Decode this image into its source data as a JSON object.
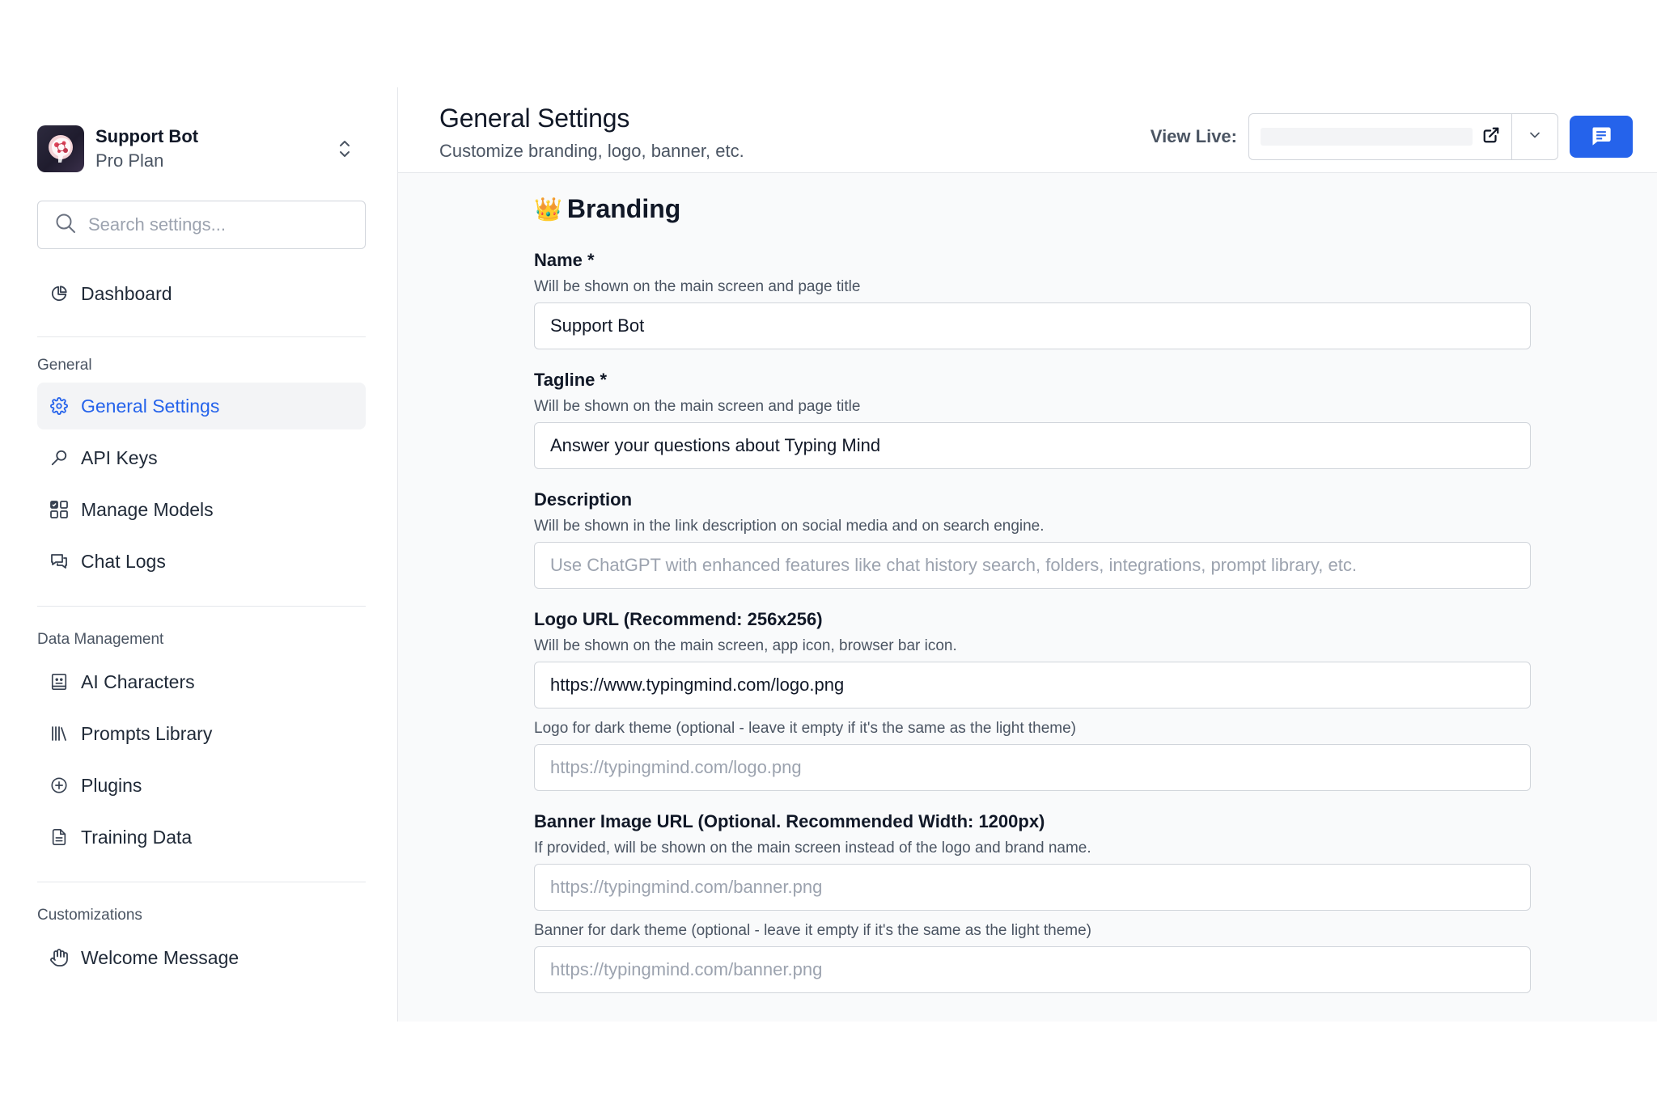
{
  "workspace": {
    "name": "Support Bot",
    "plan": "Pro Plan"
  },
  "search": {
    "placeholder": "Search settings..."
  },
  "sidebar": {
    "dashboard": "Dashboard",
    "sections": [
      {
        "title": "General",
        "items": [
          {
            "label": "General Settings",
            "icon": "gear-icon",
            "active": true
          },
          {
            "label": "API Keys",
            "icon": "key-icon"
          },
          {
            "label": "Manage Models",
            "icon": "grid-icon"
          },
          {
            "label": "Chat Logs",
            "icon": "chat-bubbles-icon"
          }
        ]
      },
      {
        "title": "Data Management",
        "items": [
          {
            "label": "AI Characters",
            "icon": "character-icon"
          },
          {
            "label": "Prompts Library",
            "icon": "library-icon"
          },
          {
            "label": "Plugins",
            "icon": "plus-circle-icon"
          },
          {
            "label": "Training Data",
            "icon": "document-icon"
          }
        ]
      },
      {
        "title": "Customizations",
        "items": [
          {
            "label": "Welcome Message",
            "icon": "hand-icon"
          }
        ]
      }
    ]
  },
  "header": {
    "title": "General Settings",
    "subtitle": "Customize branding, logo, banner, etc.",
    "view_live_label": "View Live:"
  },
  "branding": {
    "emoji": "👑",
    "heading": "Branding",
    "name": {
      "label": "Name *",
      "help": "Will be shown on the main screen and page title",
      "value": "Support Bot"
    },
    "tagline": {
      "label": "Tagline *",
      "help": "Will be shown on the main screen and page title",
      "value": "Answer your questions about Typing Mind"
    },
    "description": {
      "label": "Description",
      "help": "Will be shown in the link description on social media and on search engine.",
      "placeholder": "Use ChatGPT with enhanced features like chat history search, folders, integrations, prompt library, etc."
    },
    "logo": {
      "label": "Logo URL (Recommend: 256x256)",
      "help": "Will be shown on the main screen, app icon, browser bar icon.",
      "value": "https://www.typingmind.com/logo.png",
      "dark_help": "Logo for dark theme (optional - leave it empty if it's the same as the light theme)",
      "dark_placeholder": "https://typingmind.com/logo.png"
    },
    "banner": {
      "label": "Banner Image URL (Optional. Recommended Width: 1200px)",
      "help": "If provided, will be shown on the main screen instead of the logo and brand name.",
      "placeholder": "https://typingmind.com/banner.png",
      "dark_help": "Banner for dark theme (optional - leave it empty if it's the same as the light theme)",
      "dark_placeholder": "https://typingmind.com/banner.png"
    }
  },
  "colors": {
    "accent": "#2563eb",
    "border": "#d1d5db",
    "muted_text": "#4b5563"
  }
}
